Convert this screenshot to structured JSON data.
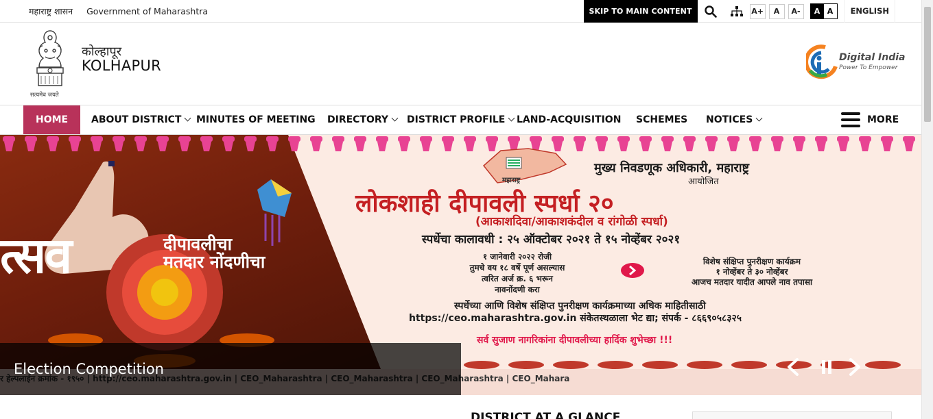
{
  "topbar": {
    "gov_marathi": "महाराष्ट्र शासन",
    "gov_english": "Government of Maharashtra",
    "skip_label": "SKIP TO MAIN CONTENT",
    "font_increase": "A+",
    "font_normal": "A",
    "font_decrease": "A-",
    "contrast_dark": "A",
    "contrast_light": "A",
    "language": "ENGLISH"
  },
  "header": {
    "emblem_motto": "सत्यमेव जयते",
    "district_marathi": "कोल्हापूर",
    "district_english": "KOLHAPUR",
    "digital_india_title": "Digital India",
    "digital_india_tagline": "Power To Empower"
  },
  "nav": {
    "items": [
      {
        "label": "HOME"
      },
      {
        "label": "ABOUT DISTRICT"
      },
      {
        "label": "MINUTES OF MEETING"
      },
      {
        "label": "DIRECTORY"
      },
      {
        "label": "DISTRICT PROFILE"
      },
      {
        "label": "LAND-ACQUISITION"
      },
      {
        "label": "SCHEMES"
      },
      {
        "label": "NOTICES"
      }
    ],
    "more_label": "MORE"
  },
  "banner": {
    "caption": "Election Competition",
    "left_big": "त्सव",
    "left_line1": "दीपावलीचा",
    "left_line2": "मतदार नोंदणीचा",
    "map_label": "महाराष्ट्र",
    "organizer": "मुख्य निवडणूक अधिकारी, महाराष्ट्र",
    "organized": "आयोजित",
    "title": "लोकशाही दीपावली स्पर्धा २०",
    "subtitle": "(आकाशदिवा/आकाशकंदील व रांगोळी स्पर्धा)",
    "period": "स्पर्धेचा कालावधी : २५ ऑक्टोबर २०२१ ते १५ नोव्हेंबर २०२१",
    "left_block": [
      "१ जानेवारी २०२२ रोजी",
      "तुमचे वय १८ वर्षे पूर्ण असल्यास",
      "त्वरित अर्ज क्र. ६ भरून",
      "नावनोंदणी करा"
    ],
    "right_block": [
      "विशेष संक्षिप्त पुनरीक्षण कार्यक्रम",
      "१ नोव्हेंबर ते ३० नोव्हेंबर",
      "आजच मतदार यादीत आपले नाव तपासा"
    ],
    "info_line1": "स्पर्धेच्या आणि विशेष संक्षिप्त पुनरीक्षण कार्यक्रमाच्या अधिक माहितीसाठी",
    "info_line2": "https://ceo.maharashtra.gov.in संकेतस्थळाला भेट द्या; संपर्क - ८६६९०५८३२५",
    "greeting": "सर्व सुजाण नागरिकांना दीपावलीच्या हार्दिक शुभेच्छा !!!",
    "strip": "र हेल्पलाईन क्रमांक - १९५०  |  http://ceo.maharashtra.gov.in  |    CEO_Maharashtra  |    CEO_Maharashtra  |    CEO_Maharashtra  |    CEO_Mahara"
  },
  "below": {
    "section_title": "DISTRICT AT A GLANCE"
  },
  "colors": {
    "nav_active": "#b8325a",
    "banner_red": "#c41f22"
  }
}
